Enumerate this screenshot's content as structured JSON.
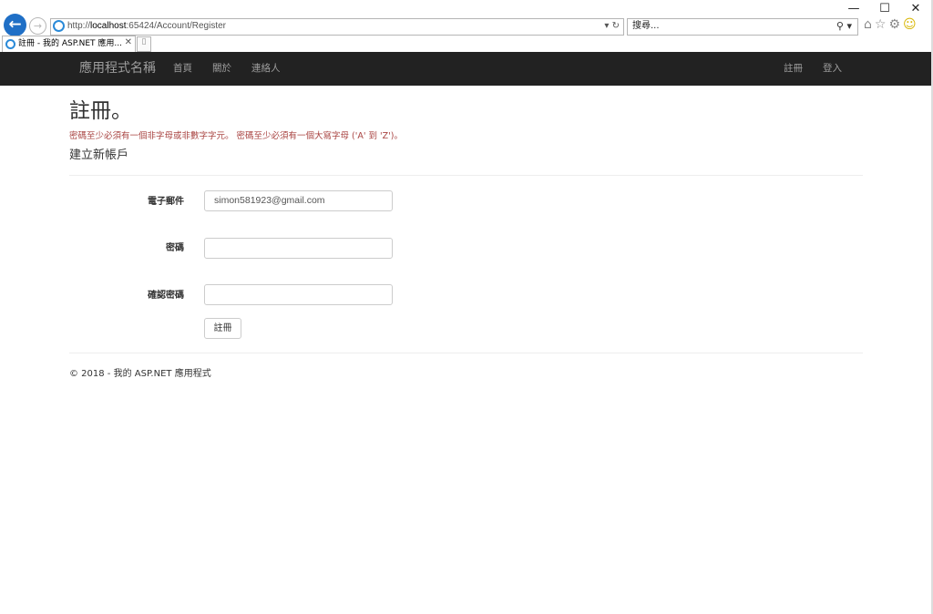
{
  "browser": {
    "window_controls": [
      "—",
      "☐",
      "✕"
    ],
    "address_prefix": "http://",
    "address_host": "localhost",
    "address_rest": ":65424/Account/Register",
    "address_actions": "▾ ↻",
    "search_placeholder": "搜尋...",
    "search_icon": "⚲ ▾",
    "tab_title": "註冊 - 我的 ASP.NET 應用...",
    "tab_close": "✕"
  },
  "navbar": {
    "brand": "應用程式名稱",
    "links": [
      "首頁",
      "關於",
      "連絡人"
    ],
    "right_links": [
      "註冊",
      "登入"
    ]
  },
  "main": {
    "title": "註冊。",
    "error": "密碼至少必須有一個非字母或非數字字元。 密碼至少必須有一個大寫字母 ('A' 到 'Z')。",
    "subtitle": "建立新帳戶",
    "fields": [
      {
        "label": "電子郵件",
        "value": "simon581923@gmail.com"
      },
      {
        "label": "密碼",
        "value": ""
      },
      {
        "label": "確認密碼",
        "value": ""
      }
    ],
    "submit": "註冊"
  },
  "footer": {
    "text": "© 2018 - 我的 ASP.NET 應用程式"
  },
  "colors": {
    "navbar_bg": "#222222",
    "error": "#a94442",
    "accent_ie": "#1f6fc6"
  }
}
